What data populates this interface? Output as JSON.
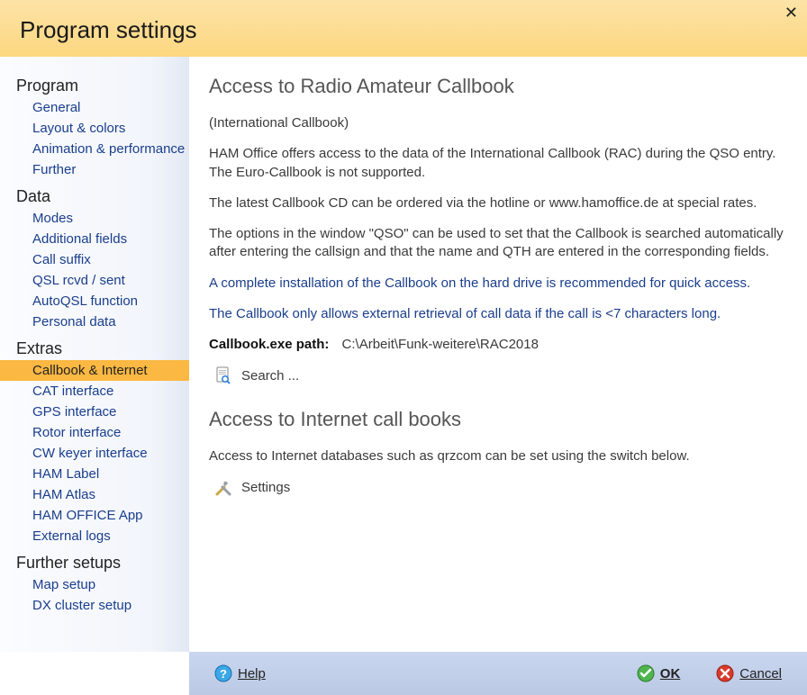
{
  "header": {
    "title": "Program settings"
  },
  "sidebar": {
    "groups": [
      {
        "title": "Program",
        "items": [
          "General",
          "Layout & colors",
          "Animation & performance",
          "Further"
        ]
      },
      {
        "title": "Data",
        "items": [
          "Modes",
          "Additional fields",
          "Call suffix",
          "QSL rcvd / sent",
          "AutoQSL function",
          "Personal data"
        ]
      },
      {
        "title": "Extras",
        "items": [
          "Callbook & Internet",
          "CAT interface",
          "GPS interface",
          "Rotor interface",
          "CW keyer interface",
          "HAM Label",
          "HAM Atlas",
          "HAM OFFICE App",
          "External logs"
        ],
        "selected_index": 0
      },
      {
        "title": "Further setups",
        "items": [
          "Map setup",
          "DX cluster setup"
        ]
      }
    ]
  },
  "main": {
    "section1": {
      "title": "Access to Radio Amateur Callbook",
      "subtitle": "(International Callbook)",
      "p1": "HAM Office offers access to the data of the International Callbook (RAC) during the QSO entry. The Euro-Callbook is not supported.",
      "p2": "The latest Callbook CD can be ordered via the hotline or www.hamoffice.de at special rates.",
      "p3": "The options in the window \"QSO\" can be used to set that the Callbook is searched automatically after entering the callsign and that the name and QTH are entered in the corresponding fields.",
      "note1": "A complete installation of the Callbook on the hard drive is recommended for quick access.",
      "note2": "The Callbook only allows external retrieval of call data if the call is <7 characters long.",
      "path_label": "Callbook.exe path:",
      "path_value": "C:\\Arbeit\\Funk-weitere\\RAC2018",
      "search_label": "Search ..."
    },
    "section2": {
      "title": "Access to Internet call books",
      "p1": "Access to Internet databases such as qrzcom can be set using the switch below.",
      "settings_label": "Settings"
    }
  },
  "footer": {
    "help": "Help",
    "ok": "OK",
    "cancel": "Cancel"
  }
}
